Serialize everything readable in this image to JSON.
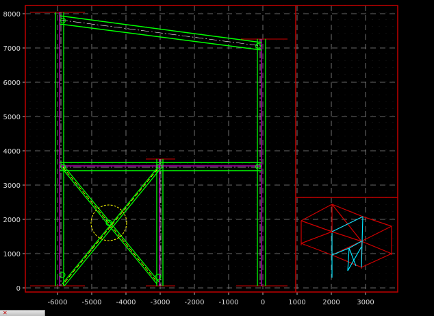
{
  "viewport": {
    "x_ticks": [
      "-6000",
      "-5000",
      "-4000",
      "-3000",
      "-2000",
      "-1000",
      "0",
      "1000",
      "2000",
      "3000"
    ],
    "y_ticks": [
      "8000",
      "7000",
      "6000",
      "5000",
      "4000",
      "3000",
      "2000",
      "1000",
      "0"
    ]
  },
  "colors": {
    "background": "#000000",
    "frame": "#c00000",
    "grid": "#8c8c8c",
    "member": "#00ff00",
    "centerline": "#ff00ff",
    "highlight": "#ffff00",
    "iso_red": "#d00000",
    "iso_cyan": "#00e5ff"
  },
  "icons": {
    "tab_close": "close-icon"
  },
  "tab": {
    "close_glyph": "✕"
  }
}
